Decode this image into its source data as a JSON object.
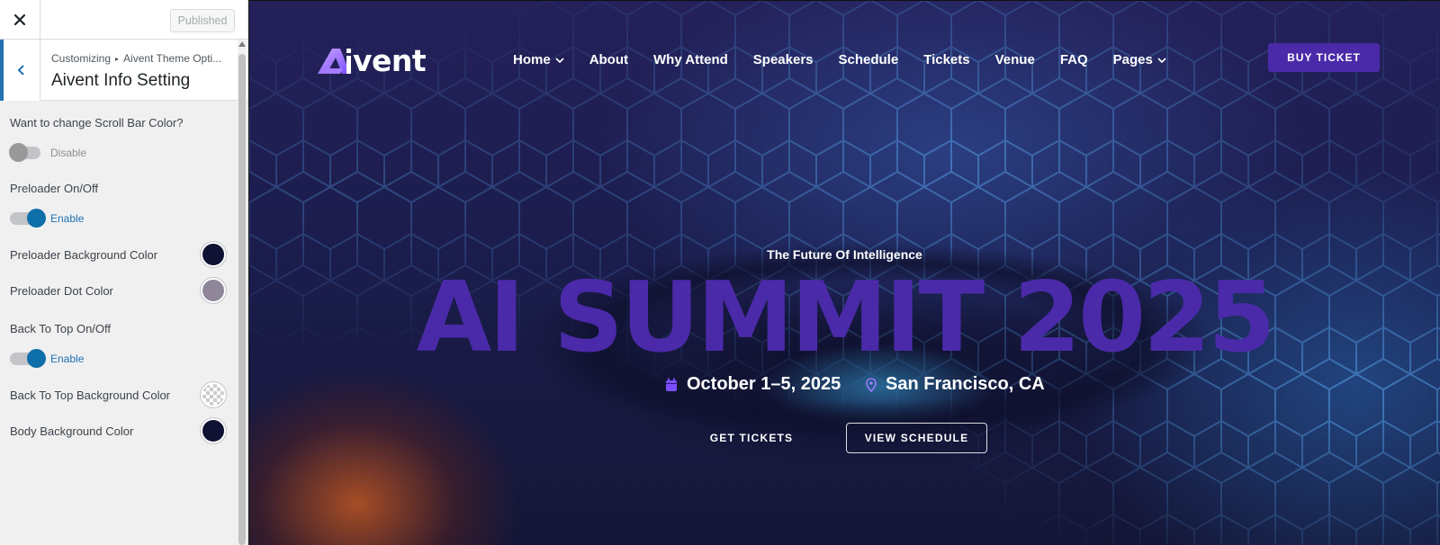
{
  "customizer": {
    "published_label": "Published",
    "breadcrumb": {
      "root": "Customizing",
      "parent": "Aivent Theme Opti..."
    },
    "panel_title": "Aivent Info Setting",
    "controls": {
      "scroll_bar": {
        "label": "Want to change Scroll Bar Color?",
        "state_label": "Disable",
        "enabled": false
      },
      "preloader": {
        "label": "Preloader On/Off",
        "state_label": "Enable",
        "enabled": true
      },
      "preloader_bg": {
        "label": "Preloader Background Color",
        "color": "#0f1232"
      },
      "preloader_dot": {
        "label": "Preloader Dot Color",
        "color": "#8f8799"
      },
      "back_to_top": {
        "label": "Back To Top On/Off",
        "state_label": "Enable",
        "enabled": true
      },
      "back_to_top_bg": {
        "label": "Back To Top Background Color",
        "color": "transparent"
      },
      "body_bg": {
        "label": "Body Background Color",
        "color": "#0f1232"
      }
    }
  },
  "site": {
    "logo_text": "vent",
    "nav": [
      "Home",
      "About",
      "Why Attend",
      "Speakers",
      "Schedule",
      "Tickets",
      "Venue",
      "FAQ",
      "Pages"
    ],
    "buy_button": "BUY TICKET",
    "tagline": "The Future Of Intelligence",
    "headline": "AI SUMMIT 2025",
    "date": "October 1–5, 2025",
    "location": "San Francisco, CA",
    "cta_primary": "GET TICKETS",
    "cta_secondary": "VIEW SCHEDULE",
    "colors": {
      "accent": "#4a2aa8",
      "headline": "#4a2aa8",
      "customizer_blue": "#2271b1"
    }
  }
}
